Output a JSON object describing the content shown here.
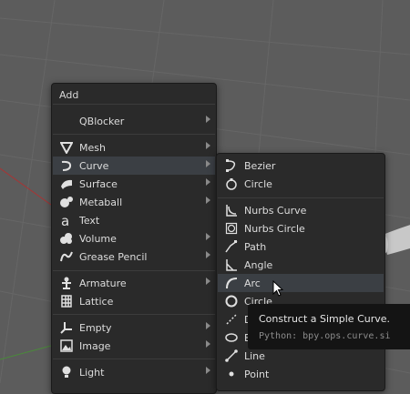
{
  "menu": {
    "title": "Add",
    "items": [
      {
        "label": "QBlocker",
        "icon": "none",
        "submenu": true
      },
      {
        "label": "Mesh",
        "icon": "mesh-icon",
        "submenu": true
      },
      {
        "label": "Curve",
        "icon": "curve-icon",
        "submenu": true,
        "highlighted": true
      },
      {
        "label": "Surface",
        "icon": "surface-icon",
        "submenu": true
      },
      {
        "label": "Metaball",
        "icon": "metaball-icon",
        "submenu": true
      },
      {
        "label": "Text",
        "icon": "text-icon",
        "submenu": false
      },
      {
        "label": "Volume",
        "icon": "volume-icon",
        "submenu": true
      },
      {
        "label": "Grease Pencil",
        "icon": "grease-pencil-icon",
        "submenu": true
      },
      {
        "label": "Armature",
        "icon": "armature-icon",
        "submenu": true
      },
      {
        "label": "Lattice",
        "icon": "lattice-icon",
        "submenu": false
      },
      {
        "label": "Empty",
        "icon": "empty-icon",
        "submenu": true
      },
      {
        "label": "Image",
        "icon": "image-icon",
        "submenu": true
      },
      {
        "label": "Light",
        "icon": "light-icon",
        "submenu": true
      }
    ]
  },
  "submenu": {
    "items": [
      {
        "label": "Bezier",
        "icon": "bezier-icon"
      },
      {
        "label": "Circle",
        "icon": "bezier-circle-icon"
      },
      {
        "label": "Nurbs Curve",
        "icon": "nurbs-curve-icon"
      },
      {
        "label": "Nurbs Circle",
        "icon": "nurbs-circle-icon"
      },
      {
        "label": "Path",
        "icon": "path-icon"
      },
      {
        "label": "Angle",
        "icon": "angle-icon"
      },
      {
        "label": "Arc",
        "icon": "arc-icon",
        "highlighted": true
      },
      {
        "label": "Circle",
        "icon": "circle-icon"
      },
      {
        "label": "D",
        "icon": "dashed-icon"
      },
      {
        "label": "E",
        "icon": "ellipse-icon"
      },
      {
        "label": "Line",
        "icon": "line-icon"
      },
      {
        "label": "Point",
        "icon": "point-icon"
      }
    ]
  },
  "tooltip": {
    "title": "Construct a Simple Curve.",
    "python": "Python: bpy.ops.curve.si"
  },
  "colors": {
    "menu_bg": "#2a2a2a",
    "highlight": "#3b3f44",
    "viewport_bg": "#5c5c5c",
    "tooltip_bg": "#141414"
  }
}
